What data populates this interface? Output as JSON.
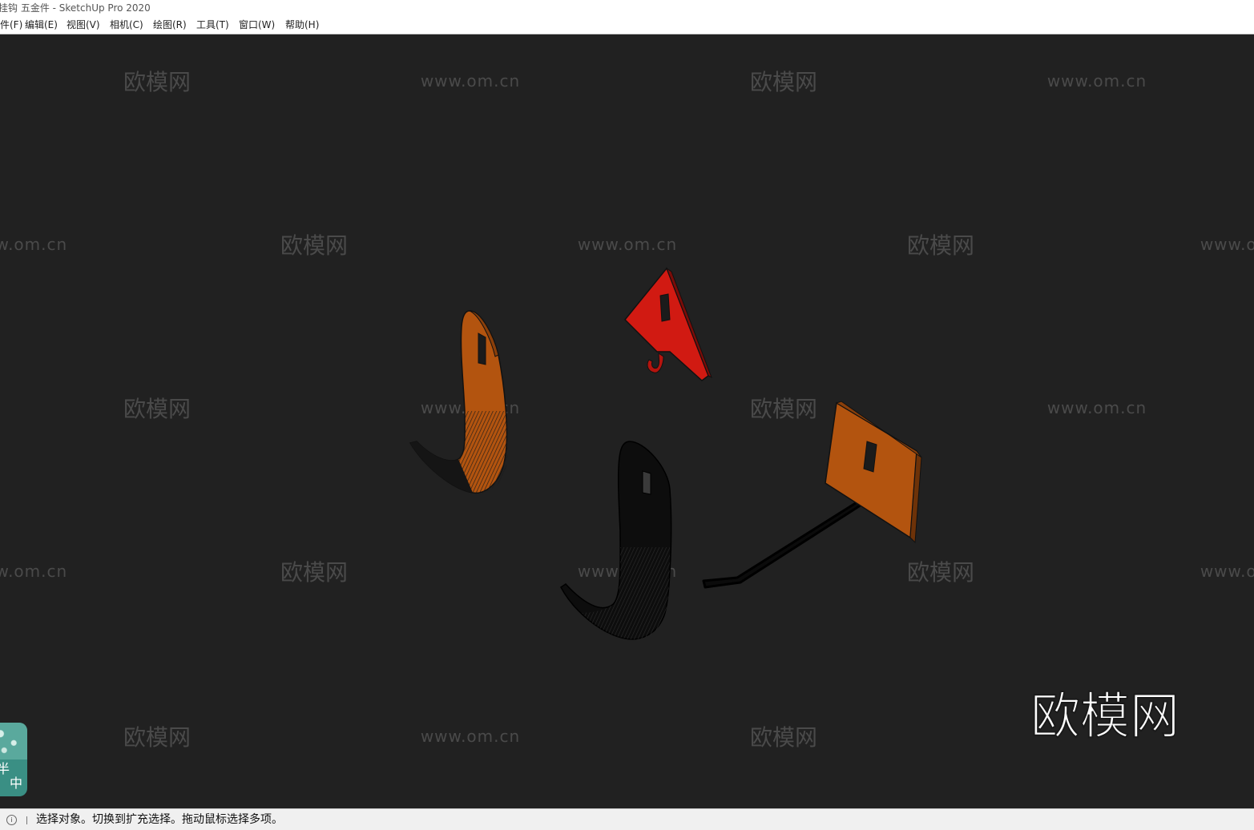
{
  "window": {
    "title": "挂钩 五金件 - SketchUp Pro 2020"
  },
  "menu": {
    "items": [
      "文件(F)",
      "编辑(E)",
      "视图(V)",
      "相机(C)",
      "绘图(R)",
      "工具(T)",
      "窗口(W)",
      "帮助(H)"
    ]
  },
  "watermarks": {
    "cn": "欧模网",
    "url": "www.om.cn"
  },
  "brand": {
    "text": "欧模网"
  },
  "ime": {
    "chars": [
      "半",
      "中"
    ]
  },
  "status": {
    "text": "选择对象。切换到扩充选择。拖动鼠标选择多项。",
    "icon": "info-icon"
  },
  "colors": {
    "viewport_bg": "#212121",
    "orange_face": "#b3540f",
    "red_face": "#d11a12",
    "black_face": "#0d0d0d"
  }
}
